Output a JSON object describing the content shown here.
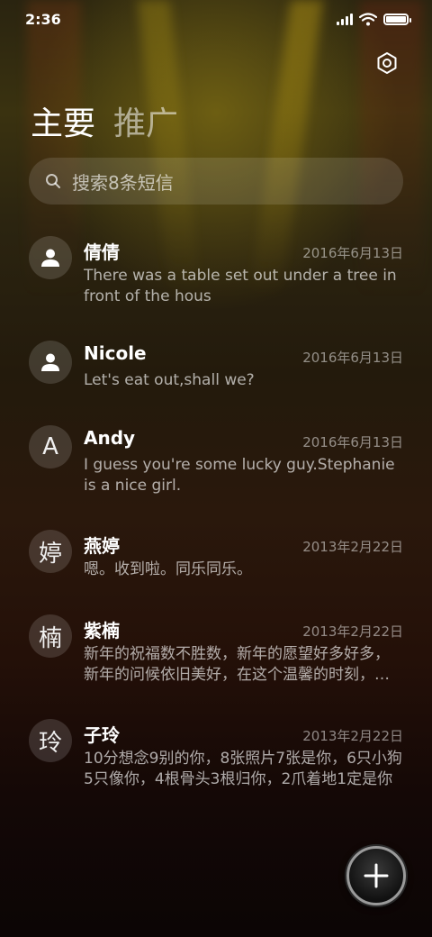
{
  "status_bar": {
    "time": "2:36"
  },
  "tabs": [
    {
      "label": "主要",
      "active": true
    },
    {
      "label": "推广",
      "active": false
    }
  ],
  "search": {
    "placeholder": "搜索8条短信"
  },
  "conversations": [
    {
      "avatar": "person-icon",
      "name": "倩倩",
      "date": "2016年6月13日",
      "preview": "There was a table set out under a tree in front of the hous"
    },
    {
      "avatar": "person-icon",
      "name": "Nicole",
      "date": "2016年6月13日",
      "preview": "Let's eat out,shall we?"
    },
    {
      "avatar": "A",
      "name": "Andy",
      "date": "2016年6月13日",
      "preview": "I guess you're some lucky guy.Stephanie is a nice girl."
    },
    {
      "avatar": "婷",
      "name": "燕婷",
      "date": "2013年2月22日",
      "preview": "嗯。收到啦。同乐同乐。"
    },
    {
      "avatar": "楠",
      "name": "紫楠",
      "date": "2013年2月22日",
      "preview": "新年的祝福数不胜数，新年的愿望好多好多，新年的问候依旧美好，在这个温馨的时刻，送上我最真的祝福"
    },
    {
      "avatar": "玲",
      "name": "子玲",
      "date": "2013年2月22日",
      "preview": "10分想念9别的你，8张照片7张是你，6只小狗5只像你，4根骨头3根归你，2爪着地1定是你"
    }
  ],
  "fab": {
    "icon": "plus-icon"
  }
}
